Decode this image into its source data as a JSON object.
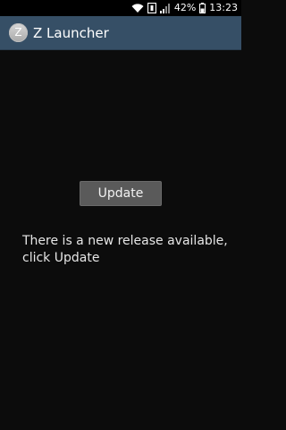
{
  "status_bar": {
    "battery_percent": "42%",
    "time": "13:23",
    "icons": [
      "wifi-icon",
      "notification-box-icon",
      "signal-icon",
      "battery-icon"
    ],
    "battery_level": 0.42
  },
  "action_bar": {
    "app_icon_letter": "Z",
    "title": "Z Launcher",
    "color": "#364f66"
  },
  "main": {
    "update_button_label": "Update",
    "message": "There is a new release available, click Update"
  }
}
